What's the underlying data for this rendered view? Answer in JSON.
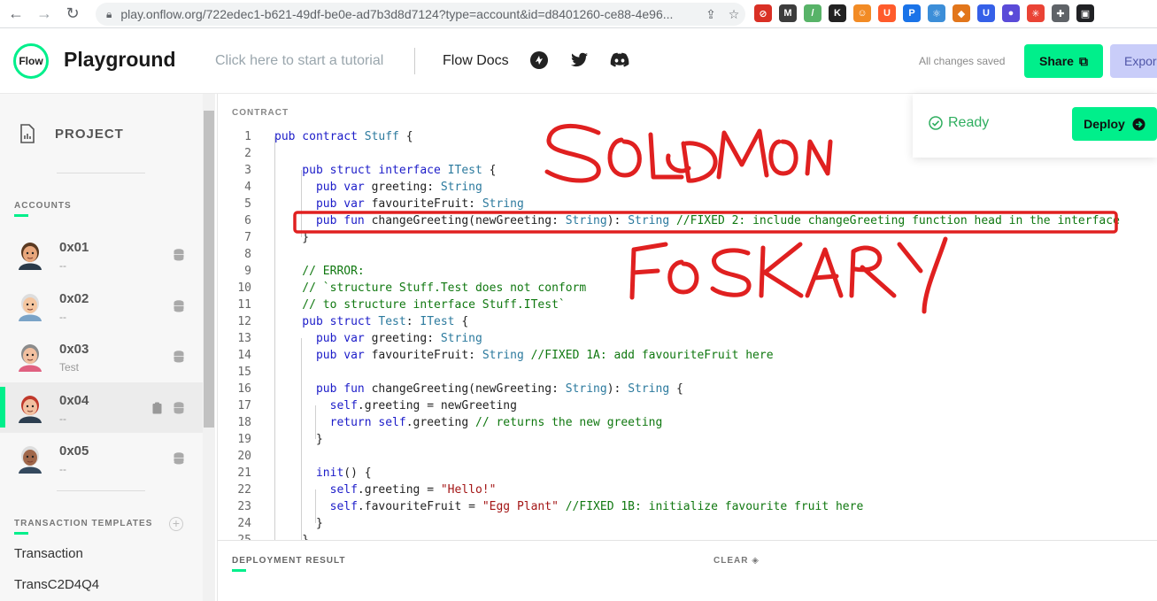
{
  "browser": {
    "url": "play.onflow.org/722edec1-b621-49df-be0e-ad7b3d8d7124?type=account&id=d8401260-ce88-4e96...",
    "extensions": [
      {
        "label": "⊘",
        "color": "#d93025"
      },
      {
        "label": "M",
        "color": "#3c3c3c"
      },
      {
        "label": "/",
        "color": "#58b368"
      },
      {
        "label": "K",
        "color": "#222222"
      },
      {
        "label": "☺",
        "color": "#f28b25"
      },
      {
        "label": "U",
        "color": "#ff5b2b"
      },
      {
        "label": "P",
        "color": "#1a73e8"
      },
      {
        "label": "⚛",
        "color": "#3c8ed8"
      },
      {
        "label": "◆",
        "color": "#e2761b"
      },
      {
        "label": "U",
        "color": "#3560e8"
      },
      {
        "label": "●",
        "color": "#5a4bd8"
      },
      {
        "label": "✳",
        "color": "#ea4335"
      },
      {
        "label": "✚",
        "color": "#5f6368"
      },
      {
        "label": "▣",
        "color": "#202124"
      }
    ]
  },
  "header": {
    "logo_text": "Flow",
    "title": "Playground",
    "tutorial": "Click here to start a tutorial",
    "docs": "Flow Docs",
    "saved": "All changes saved",
    "share": "Share",
    "export": "Expor"
  },
  "sidebar": {
    "project": "PROJECT",
    "accounts_label": "ACCOUNTS",
    "accounts": [
      {
        "address": "0x01",
        "name": "--",
        "face": "#e8a77c",
        "hair": "#5a3a22",
        "shirt": "#2a3a4a"
      },
      {
        "address": "0x02",
        "name": "--",
        "face": "#f4c6a0",
        "hair": "#dddddd",
        "shirt": "#7aa3c7"
      },
      {
        "address": "0x03",
        "name": "Test",
        "face": "#f2c0a0",
        "hair": "#8c8c8c",
        "shirt": "#e06080"
      },
      {
        "address": "0x04",
        "name": "--",
        "face": "#f2c0a0",
        "hair": "#c0392b",
        "shirt": "#2c3e50"
      },
      {
        "address": "0x05",
        "name": "--",
        "face": "#a0674a",
        "hair": "#dddddd",
        "shirt": "#34495e"
      }
    ],
    "templates_label": "TRANSACTION TEMPLATES",
    "templates": [
      "Transaction",
      "TransC2D4Q4"
    ]
  },
  "editor": {
    "label": "CONTRACT",
    "lines": [
      [
        {
          "t": "pub contract ",
          "c": "kw"
        },
        {
          "t": "Stuff",
          "c": "ty"
        },
        {
          "t": " {",
          "c": ""
        }
      ],
      [],
      [
        {
          "t": "    pub struct interface ",
          "c": "kw"
        },
        {
          "t": "ITest",
          "c": "ty"
        },
        {
          "t": " {",
          "c": ""
        }
      ],
      [
        {
          "t": "      pub var ",
          "c": "kw"
        },
        {
          "t": "greeting: ",
          "c": ""
        },
        {
          "t": "String",
          "c": "ty"
        }
      ],
      [
        {
          "t": "      pub var ",
          "c": "kw"
        },
        {
          "t": "favouriteFruit: ",
          "c": ""
        },
        {
          "t": "String",
          "c": "ty"
        }
      ],
      [
        {
          "t": "      pub fun ",
          "c": "kw"
        },
        {
          "t": "changeGreeting(newGreeting: ",
          "c": ""
        },
        {
          "t": "String",
          "c": "ty"
        },
        {
          "t": "): ",
          "c": ""
        },
        {
          "t": "String",
          "c": "ty"
        },
        {
          "t": " //FIXED 2: include changeGreeting function head in the interface",
          "c": "cm"
        }
      ],
      [
        {
          "t": "    }",
          "c": ""
        }
      ],
      [],
      [
        {
          "t": "    // ERROR:",
          "c": "cm"
        }
      ],
      [
        {
          "t": "    // `structure Stuff.Test does not conform",
          "c": "cm"
        }
      ],
      [
        {
          "t": "    // to structure interface Stuff.ITest`",
          "c": "cm"
        }
      ],
      [
        {
          "t": "    pub struct ",
          "c": "kw"
        },
        {
          "t": "Test",
          "c": "ty"
        },
        {
          "t": ": ",
          "c": ""
        },
        {
          "t": "ITest",
          "c": "ty"
        },
        {
          "t": " {",
          "c": ""
        }
      ],
      [
        {
          "t": "      pub var ",
          "c": "kw"
        },
        {
          "t": "greeting: ",
          "c": ""
        },
        {
          "t": "String",
          "c": "ty"
        }
      ],
      [
        {
          "t": "      pub var ",
          "c": "kw"
        },
        {
          "t": "favouriteFruit: ",
          "c": ""
        },
        {
          "t": "String",
          "c": "ty"
        },
        {
          "t": " //FIXED 1A: add favouriteFruit here",
          "c": "cm"
        }
      ],
      [],
      [
        {
          "t": "      pub fun ",
          "c": "kw"
        },
        {
          "t": "changeGreeting(newGreeting: ",
          "c": ""
        },
        {
          "t": "String",
          "c": "ty"
        },
        {
          "t": "): ",
          "c": ""
        },
        {
          "t": "String",
          "c": "ty"
        },
        {
          "t": " {",
          "c": ""
        }
      ],
      [
        {
          "t": "        self",
          "c": "kw"
        },
        {
          "t": ".greeting = newGreeting",
          "c": ""
        }
      ],
      [
        {
          "t": "        return self",
          "c": "kw"
        },
        {
          "t": ".greeting ",
          "c": ""
        },
        {
          "t": "// returns the new greeting",
          "c": "cm"
        }
      ],
      [
        {
          "t": "      }",
          "c": ""
        }
      ],
      [],
      [
        {
          "t": "      init",
          "c": "kw"
        },
        {
          "t": "() {",
          "c": ""
        }
      ],
      [
        {
          "t": "        self",
          "c": "kw"
        },
        {
          "t": ".greeting = ",
          "c": ""
        },
        {
          "t": "\"Hello!\"",
          "c": "str"
        }
      ],
      [
        {
          "t": "        self",
          "c": "kw"
        },
        {
          "t": ".favouriteFruit = ",
          "c": ""
        },
        {
          "t": "\"Egg Plant\"",
          "c": "str"
        },
        {
          "t": " //FIXED 1B: initialize favourite fruit here",
          "c": "cm"
        }
      ],
      [
        {
          "t": "      }",
          "c": ""
        }
      ],
      [
        {
          "t": "    }",
          "c": ""
        }
      ]
    ]
  },
  "status": {
    "ready": "Ready",
    "deploy": "Deploy"
  },
  "result": {
    "label": "DEPLOYMENT RESULT",
    "clear": "CLEAR"
  },
  "annotation": {
    "color": "#e02020"
  }
}
